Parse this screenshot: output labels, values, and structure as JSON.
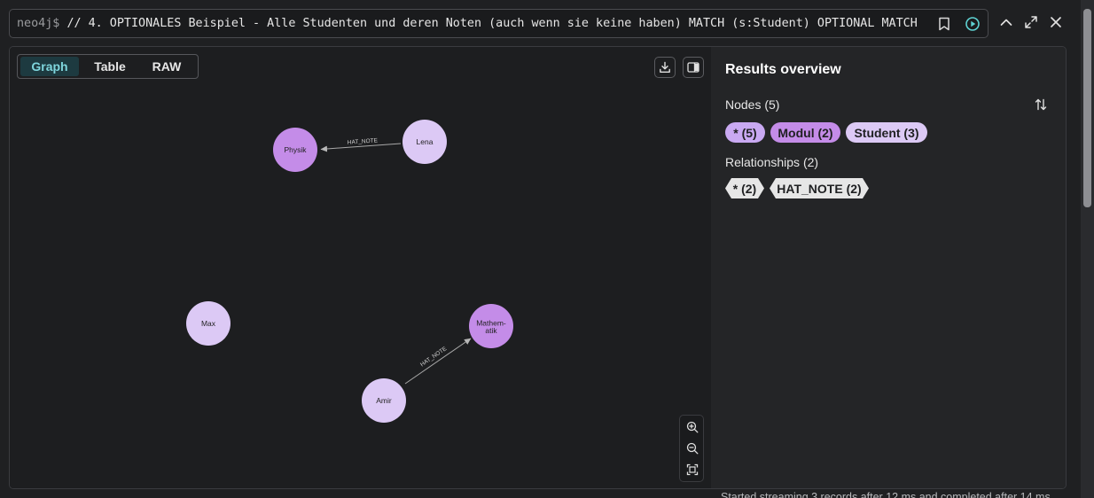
{
  "query": {
    "prompt": "neo4j$",
    "text": "// 4. OPTIONALES Beispiel - Alle Studenten und deren Noten (auch wenn sie keine haben) MATCH (s:Student) OPTIONAL MATCH"
  },
  "tabs": [
    {
      "label": "Graph",
      "active": true
    },
    {
      "label": "Table",
      "active": false
    },
    {
      "label": "RAW",
      "active": false
    }
  ],
  "graph": {
    "nodes": [
      {
        "id": "physik",
        "label": "Physik",
        "type": "Modul"
      },
      {
        "id": "lena",
        "label": "Lena",
        "type": "Student"
      },
      {
        "id": "max",
        "label": "Max",
        "type": "Student"
      },
      {
        "id": "mathematik",
        "label": "Mathem-\natik",
        "type": "Modul"
      },
      {
        "id": "amir",
        "label": "Amir",
        "type": "Student"
      }
    ],
    "relationships": [
      {
        "from": "lena",
        "to": "physik",
        "label": "HAT_NOTE"
      },
      {
        "from": "amir",
        "to": "mathematik",
        "label": "HAT_NOTE"
      }
    ]
  },
  "overview": {
    "title": "Results overview",
    "nodes_heading": "Nodes (5)",
    "node_chips": [
      {
        "label": "* (5)",
        "color": "#c9a9f2"
      },
      {
        "label": "Modul (2)",
        "color": "#c48ce8"
      },
      {
        "label": "Student (3)",
        "color": "#dcc9f5"
      }
    ],
    "relationships_heading": "Relationships (2)",
    "rel_chips": [
      {
        "label": "* (2)"
      },
      {
        "label": "HAT_NOTE (2)"
      }
    ]
  },
  "colors": {
    "modul": "#c48ce8",
    "student": "#dcc9f5",
    "accent": "#7fd6dd"
  },
  "footer": "Started streaming 3 records after 12 ms and completed after 14 ms."
}
